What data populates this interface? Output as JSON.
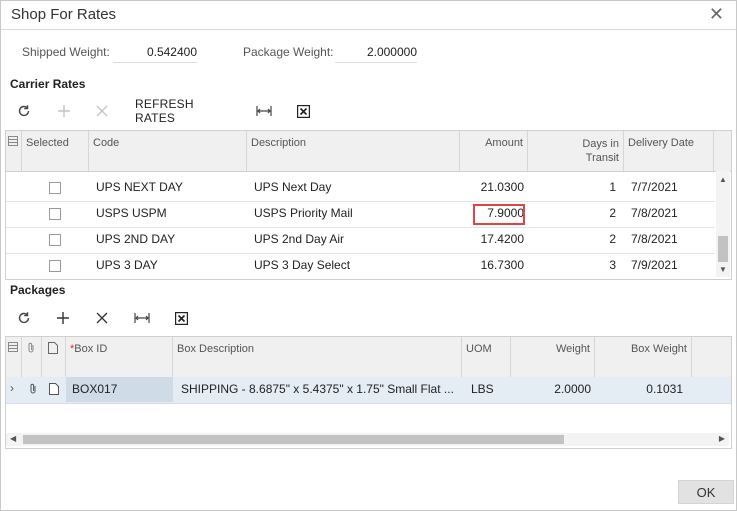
{
  "dialog": {
    "title": "Shop For Rates"
  },
  "summary": {
    "shipped_weight_label": "Shipped Weight:",
    "shipped_weight_value": "0.542400",
    "package_weight_label": "Package Weight:",
    "package_weight_value": "2.000000"
  },
  "carrier_rates": {
    "section_title": "Carrier Rates",
    "toolbar": {
      "refresh_icon": "refresh-icon",
      "add_icon": "add-icon",
      "delete_icon": "delete-icon",
      "refresh_rates_label": "REFRESH RATES",
      "fit_columns_icon": "fit-columns-icon",
      "export_excel_icon": "export-excel-icon"
    },
    "columns": {
      "selected": "Selected",
      "code": "Code",
      "description": "Description",
      "amount": "Amount",
      "days_in_transit_line1": "Days in",
      "days_in_transit_line2": "Transit",
      "delivery_date": "Delivery Date"
    },
    "rows": [
      {
        "selected": false,
        "code": "UPS NEXT DAY",
        "description": "UPS Next Day",
        "amount": "21.0300",
        "days": "1",
        "delivery_date": "7/7/2021",
        "highlighted": false
      },
      {
        "selected": false,
        "code": "USPS USPM",
        "description": "USPS Priority Mail",
        "amount": "7.9000",
        "days": "2",
        "delivery_date": "7/8/2021",
        "highlighted": true
      },
      {
        "selected": false,
        "code": "UPS 2ND DAY",
        "description": "UPS 2nd Day Air",
        "amount": "17.4200",
        "days": "2",
        "delivery_date": "7/8/2021",
        "highlighted": false
      },
      {
        "selected": false,
        "code": "UPS 3 DAY",
        "description": "UPS 3 Day Select",
        "amount": "16.7300",
        "days": "3",
        "delivery_date": "7/9/2021",
        "highlighted": false
      }
    ]
  },
  "packages": {
    "section_title": "Packages",
    "toolbar": {
      "refresh_icon": "refresh-icon",
      "add_icon": "add-icon",
      "delete_icon": "delete-icon",
      "fit_columns_icon": "fit-columns-icon",
      "export_excel_icon": "export-excel-icon"
    },
    "columns": {
      "box_id_required_mark": "*",
      "box_id": "Box ID",
      "box_description": "Box Description",
      "uom": "UOM",
      "weight": "Weight",
      "box_weight": "Box Weight"
    },
    "rows": [
      {
        "box_id": "BOX017",
        "box_description": "SHIPPING - 8.6875\" x 5.4375\" x 1.75\" Small Flat ...",
        "uom": "LBS",
        "weight": "2.0000",
        "box_weight": "0.1031"
      }
    ]
  },
  "footer": {
    "ok_label": "OK"
  }
}
